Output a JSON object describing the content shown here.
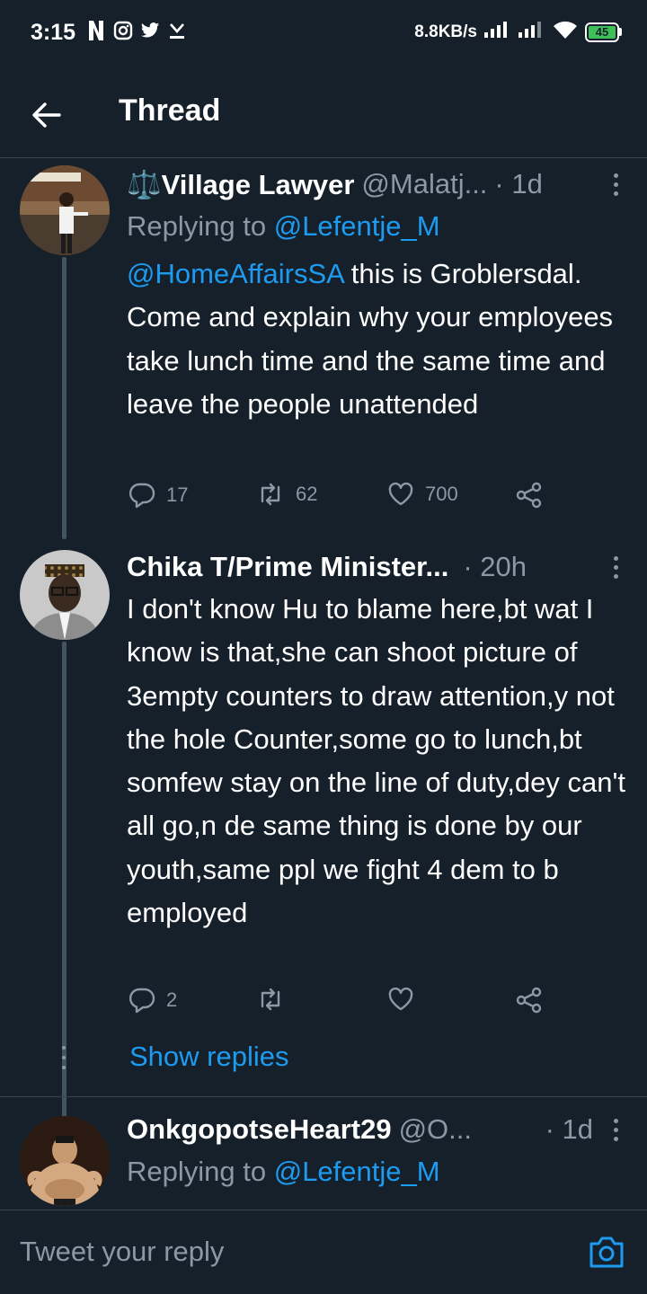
{
  "status_bar": {
    "time": "3:15",
    "icons": [
      "netflix-icon",
      "instagram-icon",
      "twitter-icon",
      "download-icon"
    ],
    "speed": "8.8KB/s",
    "battery": "45"
  },
  "header": {
    "title": "Thread"
  },
  "tweets": [
    {
      "name": "⚖️Village Lawyer",
      "handle": "@Malatj...",
      "time": "· 1d",
      "replying_prefix": "Replying to ",
      "replying_to": "@Lefentje_M",
      "text_mention": "@HomeAffairsSA",
      "text": " this is Groblersdal. Come and explain why your employees take lunch time and the same time and leave the people unattended",
      "replies": "17",
      "retweets": "62",
      "likes": "700"
    },
    {
      "name": "Chika T/Prime Minister...",
      "handle": "",
      "time": "· 20h",
      "text": "I don't know Hu to blame here,bt wat I know is that,she can shoot picture of 3empty counters to draw attention,y not the hole Counter,some go to lunch,bt somfew stay on the line of duty,dey can't all go,n de same thing is done by our youth,same ppl we fight 4 dem to b employed",
      "replies": "2",
      "retweets": "",
      "likes": ""
    },
    {
      "name": "OnkgopotseHeart29",
      "handle": "@O...",
      "time": "· 1d",
      "replying_prefix": "Replying to ",
      "replying_to": "@Lefentje_M"
    }
  ],
  "show_replies": "Show replies",
  "reply_bar": {
    "placeholder": "Tweet your reply"
  },
  "colors": {
    "background": "#15202b",
    "accent": "#1d9bf0",
    "secondary_text": "#8b98a5",
    "divider": "#38444d"
  }
}
